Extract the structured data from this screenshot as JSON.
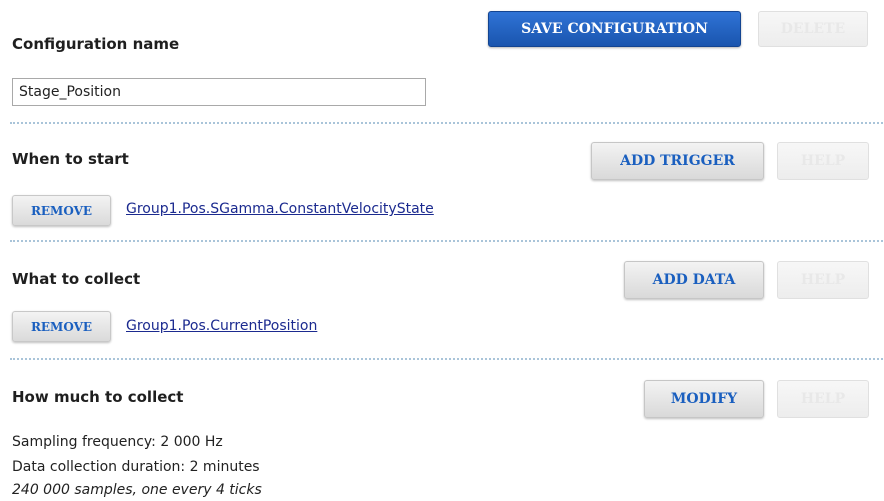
{
  "config": {
    "name_label": "Configuration name",
    "name_value": "Stage_Position",
    "save_label": "SAVE CONFIGURATION",
    "delete_label": "DELETE"
  },
  "trigger": {
    "heading": "When to start",
    "add_label": "ADD TRIGGER",
    "help_label": "HELP",
    "items": [
      {
        "remove_label": "REMOVE",
        "text": "Group1.Pos.SGamma.ConstantVelocityState"
      }
    ]
  },
  "data": {
    "heading": "What to collect",
    "add_label": "ADD DATA",
    "help_label": "HELP",
    "items": [
      {
        "remove_label": "REMOVE",
        "text": "Group1.Pos.CurrentPosition"
      }
    ]
  },
  "amount": {
    "heading": "How much to collect",
    "modify_label": "MODIFY",
    "help_label": "HELP",
    "sampling": "Sampling frequency: 2 000 Hz",
    "duration": "Data collection duration: 2 minutes",
    "samples": "240 000 samples, one every 4 ticks"
  }
}
